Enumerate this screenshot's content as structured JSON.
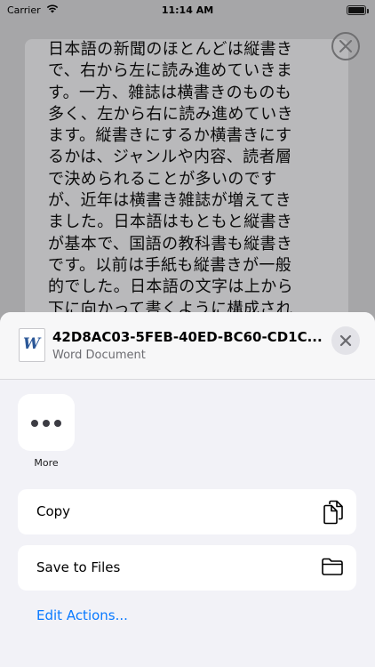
{
  "status_bar": {
    "carrier": "Carrier",
    "time": "11:14 AM",
    "battery_level": 1.0
  },
  "document": {
    "lines": [
      "日本語の新聞のほとんどは縦書き",
      "で、右から左に読み進めていきま",
      "す。一方、雑誌は横書きのものも",
      "多く、左から右に読み進めていき",
      "ます。縦書きにするか横書きにす",
      "るかは、ジャンルや内容、読者層",
      "で決められることが多いのです",
      "が、近年は横書き雑誌が増えてき",
      "ました。日本語はもともと縦書き",
      "が基本で、国語の教科書も縦書き",
      "です。以前は手紙も縦書きが一般",
      "的でした。日本語の文字は上から",
      "下に向かって書くように構成され"
    ]
  },
  "share_sheet": {
    "file_icon_letter": "W",
    "file_name": "42D8AC03-5FEB-40ED-BC60-CD1C...",
    "file_type": "Word Document",
    "more_label": "More",
    "actions": [
      {
        "label": "Copy",
        "icon": "copy-icon"
      },
      {
        "label": "Save to Files",
        "icon": "folder-icon"
      }
    ],
    "edit_actions_label": "Edit Actions..."
  },
  "colors": {
    "accent": "#0a7aff",
    "sheet_bg": "#f2f2f7",
    "dim_bg": "#a6a6a8"
  }
}
